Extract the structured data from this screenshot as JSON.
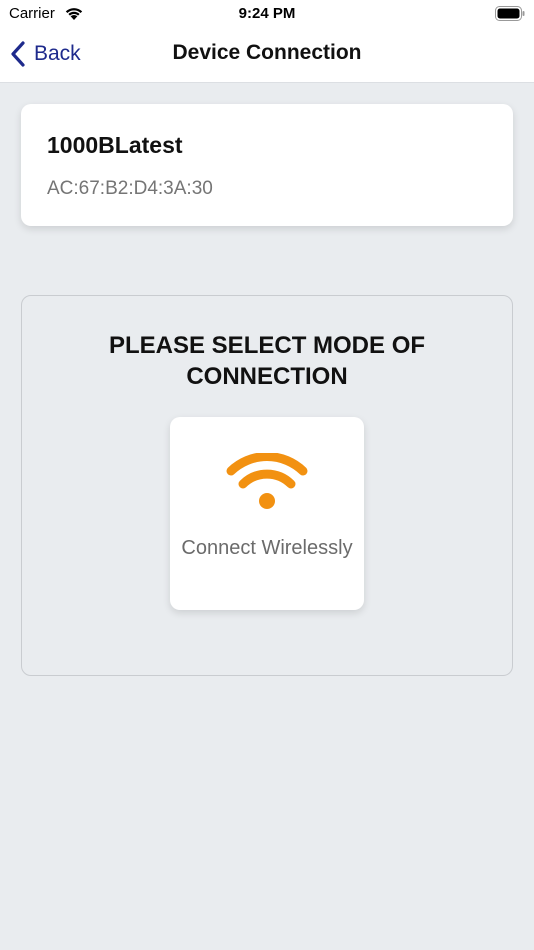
{
  "status_bar": {
    "carrier": "Carrier",
    "time": "9:24 PM"
  },
  "nav": {
    "back_label": "Back",
    "title": "Device Connection"
  },
  "device": {
    "name": "1000BLatest",
    "mac": "AC:67:B2:D4:3A:30"
  },
  "mode_selection": {
    "heading": "PLEASE SELECT MODE OF CONNECTION",
    "options": [
      {
        "label": "Connect Wirelessly",
        "icon": "wifi-icon"
      }
    ]
  },
  "colors": {
    "accent_orange": "#f29111",
    "back_blue": "#1e2a8c",
    "background": "#e9ecef"
  }
}
